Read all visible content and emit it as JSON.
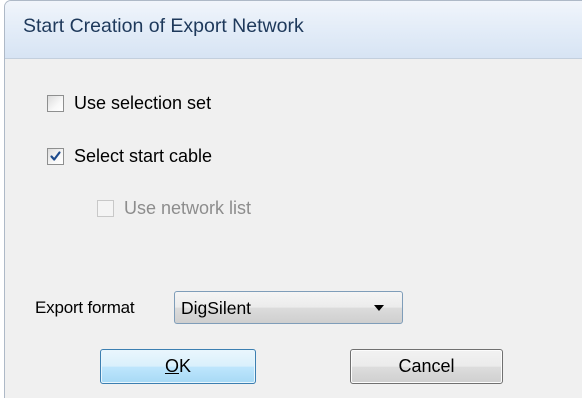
{
  "dialog": {
    "title": "Start Creation of Export Network"
  },
  "options": {
    "use_selection_set": {
      "label": "Use selection set",
      "checked": false,
      "enabled": true
    },
    "select_start_cable": {
      "label": "Select start cable",
      "checked": true,
      "enabled": true
    },
    "use_network_list": {
      "label": "Use network list",
      "checked": false,
      "enabled": false
    }
  },
  "export_format": {
    "label": "Export format",
    "selected": "DigSilent"
  },
  "buttons": {
    "ok_mnemonic": "O",
    "ok_rest": "K",
    "cancel": "Cancel"
  },
  "colors": {
    "title_text": "#1e395b",
    "dialog_background": "#f0f0f0",
    "checkmark": "#1d4a8c",
    "disabled_text": "#8d8d8d"
  },
  "icons": {
    "checkmark": "checkmark-icon",
    "dropdown_arrow": "chevron-down-icon"
  }
}
